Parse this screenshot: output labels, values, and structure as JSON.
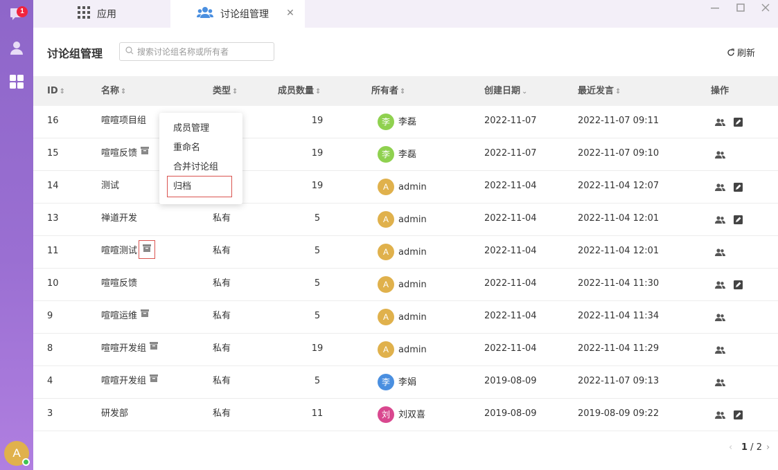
{
  "sidebar": {
    "items": [
      {
        "name": "messages",
        "icon": "chat-bubble-icon",
        "badge": "1"
      },
      {
        "name": "contacts",
        "icon": "user-icon"
      },
      {
        "name": "apps",
        "icon": "grid-icon"
      }
    ],
    "user_avatar": "A"
  },
  "tabs": [
    {
      "label": "应用",
      "icon": "apps-grid-icon"
    },
    {
      "label": "讨论组管理",
      "icon": "group-icon",
      "active": true
    }
  ],
  "header": {
    "title": "讨论组管理",
    "search_placeholder": "搜索讨论组名称或所有者",
    "refresh_label": "刷新"
  },
  "table": {
    "columns": [
      "ID",
      "名称",
      "类型",
      "成员数量",
      "所有者",
      "创建日期",
      "最近发言",
      "操作"
    ],
    "rows": [
      {
        "id": "16",
        "name": "喧喧项目组",
        "archived": false,
        "type": "",
        "members": "19",
        "owner": "李磊",
        "avatar": "李",
        "avatar_color": "#8fd14f",
        "created": "2022-11-07",
        "last": "2022-11-07 09:11",
        "edit": true
      },
      {
        "id": "15",
        "name": "喧喧反馈",
        "archived": true,
        "type": "",
        "members": "19",
        "owner": "李磊",
        "avatar": "李",
        "avatar_color": "#8fd14f",
        "created": "2022-11-07",
        "last": "2022-11-07 09:10",
        "edit": false
      },
      {
        "id": "14",
        "name": "测试",
        "archived": false,
        "type": "",
        "members": "19",
        "owner": "admin",
        "avatar": "A",
        "avatar_color": "#e0b14c",
        "created": "2022-11-04",
        "last": "2022-11-04 12:07",
        "edit": true
      },
      {
        "id": "13",
        "name": "禅道开发",
        "archived": false,
        "type": "私有",
        "members": "5",
        "owner": "admin",
        "avatar": "A",
        "avatar_color": "#e0b14c",
        "created": "2022-11-04",
        "last": "2022-11-04 12:01",
        "edit": true
      },
      {
        "id": "11",
        "name": "喧喧测试",
        "archived": true,
        "highlight": true,
        "type": "私有",
        "members": "5",
        "owner": "admin",
        "avatar": "A",
        "avatar_color": "#e0b14c",
        "created": "2022-11-04",
        "last": "2022-11-04 12:01",
        "edit": false
      },
      {
        "id": "10",
        "name": "喧喧反馈",
        "archived": false,
        "type": "私有",
        "members": "5",
        "owner": "admin",
        "avatar": "A",
        "avatar_color": "#e0b14c",
        "created": "2022-11-04",
        "last": "2022-11-04 11:30",
        "edit": true
      },
      {
        "id": "9",
        "name": "喧喧运维",
        "archived": true,
        "type": "私有",
        "members": "5",
        "owner": "admin",
        "avatar": "A",
        "avatar_color": "#e0b14c",
        "created": "2022-11-04",
        "last": "2022-11-04 11:34",
        "edit": false
      },
      {
        "id": "8",
        "name": "喧喧开发组",
        "archived": true,
        "type": "私有",
        "members": "19",
        "owner": "admin",
        "avatar": "A",
        "avatar_color": "#e0b14c",
        "created": "2022-11-04",
        "last": "2022-11-04 11:29",
        "edit": false
      },
      {
        "id": "4",
        "name": "喧喧开发组",
        "archived": true,
        "type": "私有",
        "members": "5",
        "owner": "李娟",
        "avatar": "李",
        "avatar_color": "#4a8fe0",
        "created": "2019-08-09",
        "last": "2022-11-07 09:13",
        "edit": false
      },
      {
        "id": "3",
        "name": "研发部",
        "archived": false,
        "type": "私有",
        "members": "11",
        "owner": "刘双喜",
        "avatar": "刘",
        "avatar_color": "#d9488f",
        "created": "2019-08-09",
        "last": "2019-08-09 09:22",
        "edit": true
      }
    ]
  },
  "context_menu": {
    "items": [
      "成员管理",
      "重命名",
      "合并讨论组",
      "归档"
    ],
    "highlighted": "归档"
  },
  "pagination": {
    "current": "1",
    "total": "2"
  }
}
